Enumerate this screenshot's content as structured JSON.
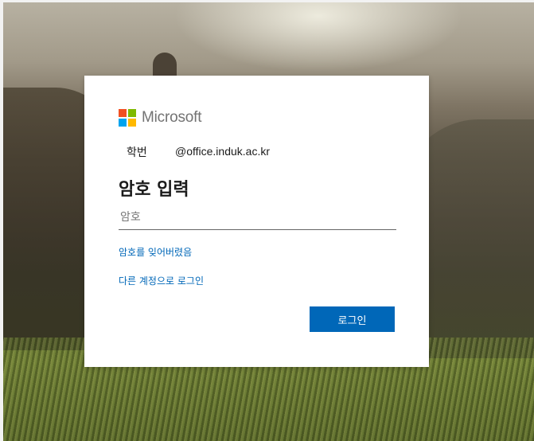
{
  "background": {
    "description_icon": "mountain-landscape-background"
  },
  "card": {
    "brand": {
      "name": "Microsoft",
      "logo_colors": [
        "#f25022",
        "#7fba00",
        "#00a4ef",
        "#ffb900"
      ]
    },
    "identity": {
      "user": "학번",
      "domain": "@office.induk.ac.kr"
    },
    "title": "암호 입력",
    "password_field": {
      "placeholder": "암호",
      "value": ""
    },
    "links": {
      "forgot_password": "암호를 잊어버렸음",
      "other_account": "다른 계정으로 로그인"
    },
    "login_button": "로그인",
    "accent_color": "#0067b8"
  }
}
